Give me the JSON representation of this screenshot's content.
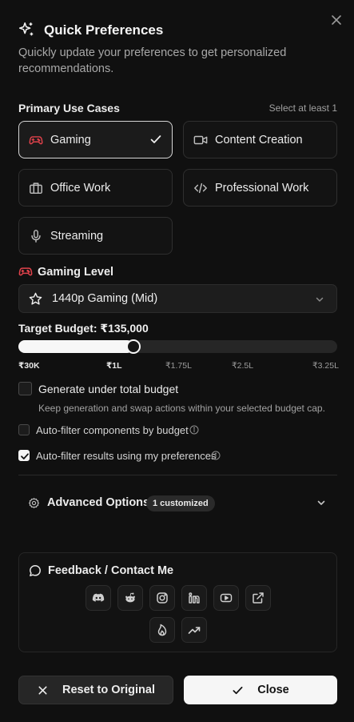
{
  "header": {
    "title": "Quick Preferences",
    "subtitle": "Quickly update your preferences to get personalized recommendations.",
    "icon": "sparkles-icon",
    "close_icon": "close-icon"
  },
  "use_cases": {
    "label": "Primary Use Cases",
    "hint": "Select at least 1",
    "items": [
      {
        "label": "Gaming",
        "icon": "gamepad-icon",
        "selected": true
      },
      {
        "label": "Content Creation",
        "icon": "video-icon",
        "selected": false
      },
      {
        "label": "Office Work",
        "icon": "briefcase-icon",
        "selected": false
      },
      {
        "label": "Professional Work",
        "icon": "code-icon",
        "selected": false
      },
      {
        "label": "Streaming",
        "icon": "microphone-icon",
        "selected": false
      }
    ]
  },
  "gaming_level": {
    "label": "Gaming Level",
    "selected": "1440p Gaming (Mid)"
  },
  "budget": {
    "label": "Target Budget: ₹135,000",
    "value": 135000,
    "slider_fraction": 0.36,
    "ticks": [
      "₹30K",
      "₹1L",
      "₹1.75L",
      "₹2.5L",
      "₹3.25L"
    ]
  },
  "options": {
    "generate_under_total": {
      "label": "Generate under total budget",
      "description": "Keep generation and swap actions within your selected budget cap.",
      "checked": false
    },
    "auto_filter_components": {
      "label": "Auto-filter components by budget",
      "checked": false
    },
    "auto_filter_results": {
      "label": "Auto-filter results using my preferences",
      "checked": true
    }
  },
  "advanced": {
    "label": "Advanced Options",
    "badge": "1 customized"
  },
  "feedback": {
    "label": "Feedback / Contact Me",
    "links": [
      "discord-icon",
      "reddit-icon",
      "instagram-icon",
      "linkedin-icon",
      "youtube-icon",
      "external-link-icon",
      "flame-icon",
      "trending-icon"
    ]
  },
  "footer": {
    "reset_label": "Reset to Original",
    "close_label": "Close"
  },
  "colors": {
    "background": "#101010",
    "accent_red": "#e0424b",
    "primary_button": "#f6f6f6"
  }
}
